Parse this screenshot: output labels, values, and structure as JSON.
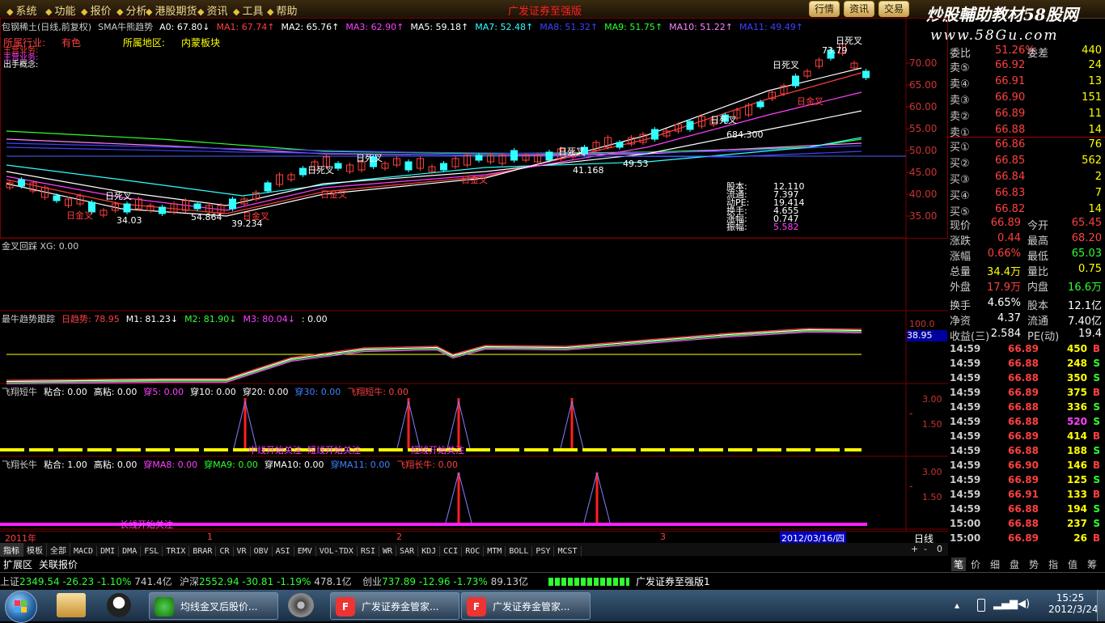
{
  "menu": {
    "items": [
      "系统",
      "功能",
      "报价",
      "分析",
      "港股期货",
      "资讯",
      "工具",
      "帮助"
    ],
    "center_title": "广发证券至强版",
    "right_buttons": [
      "行情",
      "资讯",
      "交易"
    ]
  },
  "watermark": {
    "text": "炒股輔助教材58股网",
    "url": "www.58Gu.com"
  },
  "main_panel": {
    "title_items": [
      {
        "t": "包钢稀土(日线,前复权)",
        "c": "#ccc"
      },
      {
        "t": "SMA牛熊趋势",
        "c": "#ccc"
      },
      {
        "t": "A0: 67.80↓",
        "c": "#fff"
      },
      {
        "t": "MA1: 67.74↑",
        "c": "#ff4040"
      },
      {
        "t": "MA2: 65.76↑",
        "c": "#fff"
      },
      {
        "t": "MA3: 62.90↑",
        "c": "#ff40ff"
      },
      {
        "t": "MA5: 59.18↑",
        "c": "#fff"
      },
      {
        "t": "MA7: 52.48↑",
        "c": "#30ffff"
      },
      {
        "t": "MA8: 51.32↑",
        "c": "#4040ff"
      },
      {
        "t": "MA9: 51.75↑",
        "c": "#30ff30"
      },
      {
        "t": "MA10: 51.22↑",
        "c": "#ff80ff"
      },
      {
        "t": "MA11: 49.49↑",
        "c": "#4040ff"
      }
    ],
    "info": [
      {
        "label": "所属行业:",
        "value": "有色"
      },
      {
        "label": "所属地区:",
        "value": "内蒙板块"
      }
    ],
    "side_labels": [
      "主营业务:",
      "主营业务:",
      "出手概念:"
    ],
    "y_ticks": [
      "70.00",
      "65.00",
      "60.00",
      "55.00",
      "50.00",
      "45.00",
      "40.00",
      "35.00"
    ],
    "annotations": [
      "日死叉",
      "日死叉",
      "日死叉",
      "日死叉",
      "日死叉",
      "日死叉",
      "日死叉",
      "日金叉",
      "日金叉",
      "日金叉",
      "日金叉",
      "日金叉",
      "73.79",
      "34.03",
      "54.864",
      "39.234",
      "41.168",
      "684.300",
      "49.53"
    ],
    "stats": [
      {
        "k": "股本:",
        "v": "12.110"
      },
      {
        "k": "流通:",
        "v": "7.397"
      },
      {
        "k": "动PE:",
        "v": "19.414"
      },
      {
        "k": "换手:",
        "v": "4.655"
      },
      {
        "k": "涨幅:",
        "v": "0.747"
      },
      {
        "k": "振幅:",
        "v": "5.582"
      }
    ]
  },
  "panel2": {
    "title": "金叉回踩 XG: 0.00"
  },
  "panel3": {
    "title_items": [
      {
        "t": "最牛趋势跟踪",
        "c": "#ccc"
      },
      {
        "t": "日趋势: 78.95",
        "c": "#ff4040"
      },
      {
        "t": "M1: 81.23↓",
        "c": "#fff"
      },
      {
        "t": "M2: 81.90↓",
        "c": "#30ff30"
      },
      {
        "t": "M3: 80.04↓",
        "c": "#ff40ff"
      },
      {
        "t": ": 0.00",
        "c": "#fff"
      }
    ],
    "y_ticks": [
      "100.0",
      "38.95"
    ]
  },
  "panel4": {
    "title_items": [
      {
        "t": "飞翔短牛",
        "c": "#ccc"
      },
      {
        "t": "粘合: 0.00",
        "c": "#fff"
      },
      {
        "t": "高粘: 0.00",
        "c": "#fff"
      },
      {
        "t": "穿5: 0.00",
        "c": "#ff40ff"
      },
      {
        "t": "穿10: 0.00",
        "c": "#fff"
      },
      {
        "t": "穿20: 0.00",
        "c": "#fff"
      },
      {
        "t": "穿30: 0.00",
        "c": "#4080ff"
      },
      {
        "t": "飞翔短牛: 0.00",
        "c": "#ff4040"
      }
    ],
    "y_ticks": [
      "3.00",
      "1.50"
    ],
    "labels": [
      "中线开始关注",
      "短线开始关注",
      "短线开始关注"
    ]
  },
  "panel5": {
    "title_items": [
      {
        "t": "飞翔长牛",
        "c": "#ccc"
      },
      {
        "t": "粘合: 1.00",
        "c": "#fff"
      },
      {
        "t": "高粘: 0.00",
        "c": "#fff"
      },
      {
        "t": "穿MA8: 0.00",
        "c": "#ff40ff"
      },
      {
        "t": "穿MA9: 0.00",
        "c": "#30ff30"
      },
      {
        "t": "穿MA10: 0.00",
        "c": "#fff"
      },
      {
        "t": "穿MA11: 0.00",
        "c": "#4080ff"
      },
      {
        "t": "飞翔长牛: 0.00",
        "c": "#ff4040"
      }
    ],
    "y_ticks": [
      "3.00",
      "1.50"
    ],
    "labels": [
      "长线开始关注"
    ]
  },
  "x_axis": {
    "labels": [
      "2011年",
      "1",
      "2",
      "3"
    ],
    "current_date": "2012/03/16/四",
    "period": "日线"
  },
  "tabs": [
    "指标",
    "模板",
    "全部",
    "MACD",
    "DMI",
    "DMA",
    "FSL",
    "TRIX",
    "BRAR",
    "CR",
    "VR",
    "OBV",
    "ASI",
    "EMV",
    "VOL-TDX",
    "RSI",
    "WR",
    "SAR",
    "KDJ",
    "CCI",
    "ROC",
    "MTM",
    "BOLL",
    "PSY",
    "MCST"
  ],
  "bottom_tabs": [
    "扩展区",
    "关联报价"
  ],
  "quote": {
    "wei_bi": {
      "label": "委比",
      "value": "51.26%",
      "label2": "委差",
      "value2": "440"
    },
    "sell": [
      {
        "l": "卖⑤",
        "p": "66.92",
        "v": "24"
      },
      {
        "l": "卖④",
        "p": "66.91",
        "v": "13"
      },
      {
        "l": "卖③",
        "p": "66.90",
        "v": "151"
      },
      {
        "l": "卖②",
        "p": "66.89",
        "v": "11"
      },
      {
        "l": "卖①",
        "p": "66.88",
        "v": "14"
      }
    ],
    "buy": [
      {
        "l": "买①",
        "p": "66.86",
        "v": "76"
      },
      {
        "l": "买②",
        "p": "66.85",
        "v": "562"
      },
      {
        "l": "买③",
        "p": "66.84",
        "v": "2"
      },
      {
        "l": "买④",
        "p": "66.83",
        "v": "7"
      },
      {
        "l": "买⑤",
        "p": "66.82",
        "v": "14"
      }
    ],
    "stats": [
      {
        "l1": "现价",
        "v1": "66.89",
        "c1": "#ff4040",
        "l2": "今开",
        "v2": "65.45",
        "c2": "#ff4040"
      },
      {
        "l1": "涨跌",
        "v1": "0.44",
        "c1": "#ff4040",
        "l2": "最高",
        "v2": "68.20",
        "c2": "#ff4040"
      },
      {
        "l1": "涨幅",
        "v1": "0.66%",
        "c1": "#ff4040",
        "l2": "最低",
        "v2": "65.03",
        "c2": "#30ff30"
      },
      {
        "l1": "总量",
        "v1": "34.4万",
        "c1": "#ff0",
        "l2": "量比",
        "v2": "0.75",
        "c2": "#ff0"
      },
      {
        "l1": "外盘",
        "v1": "17.9万",
        "c1": "#ff4040",
        "l2": "内盘",
        "v2": "16.6万",
        "c2": "#30ff30"
      },
      {
        "l1": "换手",
        "v1": "4.65%",
        "c1": "#fff",
        "l2": "股本",
        "v2": "12.1亿",
        "c2": "#fff"
      },
      {
        "l1": "净资",
        "v1": "4.37",
        "c1": "#fff",
        "l2": "流通",
        "v2": "7.40亿",
        "c2": "#fff"
      },
      {
        "l1": "收益(三)",
        "v1": "2.584",
        "c1": "#fff",
        "l2": "PE(动)",
        "v2": "19.4",
        "c2": "#fff"
      }
    ],
    "ticks": [
      {
        "t": "14:59",
        "p": "66.89",
        "v": "450",
        "b": "B",
        "bc": "#ff4040",
        "vc": "#ff0"
      },
      {
        "t": "14:59",
        "p": "66.88",
        "v": "248",
        "b": "S",
        "bc": "#30ff30",
        "vc": "#ff0"
      },
      {
        "t": "14:59",
        "p": "66.88",
        "v": "350",
        "b": "S",
        "bc": "#30ff30",
        "vc": "#ff0"
      },
      {
        "t": "14:59",
        "p": "66.89",
        "v": "375",
        "b": "B",
        "bc": "#ff4040",
        "vc": "#ff0"
      },
      {
        "t": "14:59",
        "p": "66.88",
        "v": "336",
        "b": "S",
        "bc": "#30ff30",
        "vc": "#ff0"
      },
      {
        "t": "14:59",
        "p": "66.88",
        "v": "520",
        "b": "S",
        "bc": "#30ff30",
        "vc": "#ff40ff"
      },
      {
        "t": "14:59",
        "p": "66.89",
        "v": "414",
        "b": "B",
        "bc": "#ff4040",
        "vc": "#ff0"
      },
      {
        "t": "14:59",
        "p": "66.88",
        "v": "188",
        "b": "S",
        "bc": "#30ff30",
        "vc": "#ff0"
      },
      {
        "t": "14:59",
        "p": "66.90",
        "v": "146",
        "b": "B",
        "bc": "#ff4040",
        "vc": "#ff0"
      },
      {
        "t": "14:59",
        "p": "66.89",
        "v": "125",
        "b": "S",
        "bc": "#30ff30",
        "vc": "#ff0"
      },
      {
        "t": "14:59",
        "p": "66.91",
        "v": "133",
        "b": "B",
        "bc": "#ff4040",
        "vc": "#ff0"
      },
      {
        "t": "14:59",
        "p": "66.88",
        "v": "194",
        "b": "S",
        "bc": "#30ff30",
        "vc": "#ff0"
      },
      {
        "t": "15:00",
        "p": "66.88",
        "v": "237",
        "b": "S",
        "bc": "#30ff30",
        "vc": "#ff0"
      },
      {
        "t": "15:00",
        "p": "66.89",
        "v": "26",
        "b": "B",
        "bc": "#ff4040",
        "vc": "#ff0"
      }
    ],
    "right_tabs": [
      "笔",
      "价",
      "细",
      "盘",
      "势",
      "指",
      "值",
      "筹"
    ]
  },
  "index_bar": [
    {
      "name": "上证",
      "price": "2349.54",
      "chg": "-26.23",
      "pct": "-1.10%",
      "amt": "741.4亿"
    },
    {
      "name": "沪深",
      "price": "2552.94",
      "chg": "-30.81",
      "pct": "-1.19%",
      "amt": "478.1亿"
    },
    {
      "name": "创业",
      "price": "737.89",
      "chg": "-12.96",
      "pct": "-1.73%",
      "amt": "89.13亿"
    }
  ],
  "index_bar_right": "广发证券至强版1",
  "taskbar": {
    "tasks": [
      "均线金叉后股价...",
      "广发证券金管家...",
      "广发证券金管家..."
    ],
    "clock_time": "15:25",
    "clock_date": "2012/3/24"
  },
  "colors": {
    "up": "#ff4040",
    "down": "#30ff30",
    "grid": "#660000"
  }
}
